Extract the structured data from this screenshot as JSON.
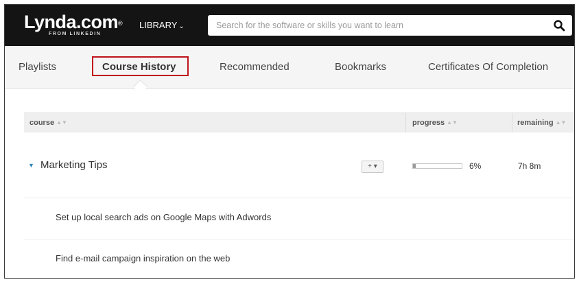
{
  "header": {
    "logo_text": "Lynda.com",
    "logo_mark": "®",
    "logo_subtext": "FROM LINKEDIN",
    "library_label": "LIBRARY",
    "search_placeholder": "Search for the software or skills you want to learn",
    "search_icon": "search-icon"
  },
  "tabs": [
    {
      "label": "Playlists"
    },
    {
      "label": "Course History",
      "active": true
    },
    {
      "label": "Recommended"
    },
    {
      "label": "Bookmarks"
    },
    {
      "label": "Certificates Of Completion"
    }
  ],
  "table": {
    "columns": {
      "course": "course",
      "progress": "progress",
      "remaining": "remaining"
    },
    "group": {
      "title": "Marketing Tips",
      "add_label": "+ ▾",
      "progress_fraction": 0.06,
      "progress_text": "6%",
      "remaining": "7h 8m"
    },
    "items": [
      {
        "title": "Set up local search ads on Google Maps with Adwords"
      },
      {
        "title": "Find e-mail campaign inspiration on the web"
      }
    ]
  },
  "colors": {
    "topbar": "#141414",
    "highlight": "#c0121b",
    "toggle": "#2f86b9"
  }
}
